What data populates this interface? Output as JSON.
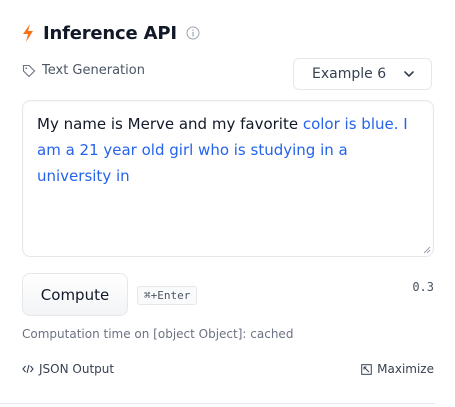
{
  "header": {
    "title": "Inference API",
    "icon": "lightning-icon",
    "info_icon": "info-icon"
  },
  "task": {
    "label": "Text Generation",
    "icon": "tag-icon"
  },
  "example_select": {
    "selected": "Example 6",
    "icon": "chevron-down-icon"
  },
  "input": {
    "prompt": "My name is Merve and my favorite ",
    "generated": "color is blue. I am a 21 year old girl who is studying in a university in"
  },
  "compute": {
    "label": "Compute",
    "shortcut": "⌘+Enter"
  },
  "score": "0.3",
  "computation_time": "Computation time on [object Object]: cached",
  "footer": {
    "json_output": "JSON Output",
    "maximize": "Maximize"
  },
  "colors": {
    "accent": "#f97316",
    "generated_text": "#2563eb",
    "border": "#e5e7eb"
  }
}
